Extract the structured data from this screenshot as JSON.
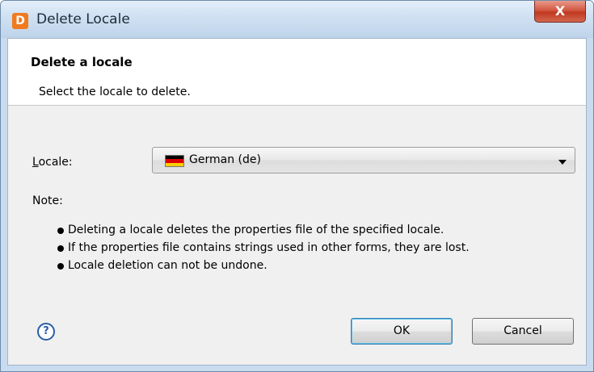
{
  "window": {
    "title": "Delete Locale",
    "app_icon_letter": "D",
    "close_label": "X"
  },
  "header": {
    "title": "Delete a locale",
    "description": "Select the locale to delete."
  },
  "form": {
    "locale_label_mnemonic": "L",
    "locale_label_rest": "ocale:",
    "locale_value": "German (de)",
    "locale_flag": {
      "colors": [
        "#000000",
        "#dd0000",
        "#ffce00"
      ]
    }
  },
  "note": {
    "label": "Note:",
    "items": [
      "Deleting a locale deletes the properties file of the specified locale.",
      "If the properties file contains strings used in other forms, they are lost.",
      "Locale deletion can not be undone."
    ]
  },
  "buttons": {
    "help_glyph": "?",
    "ok_label": "OK",
    "cancel_label": "Cancel"
  }
}
